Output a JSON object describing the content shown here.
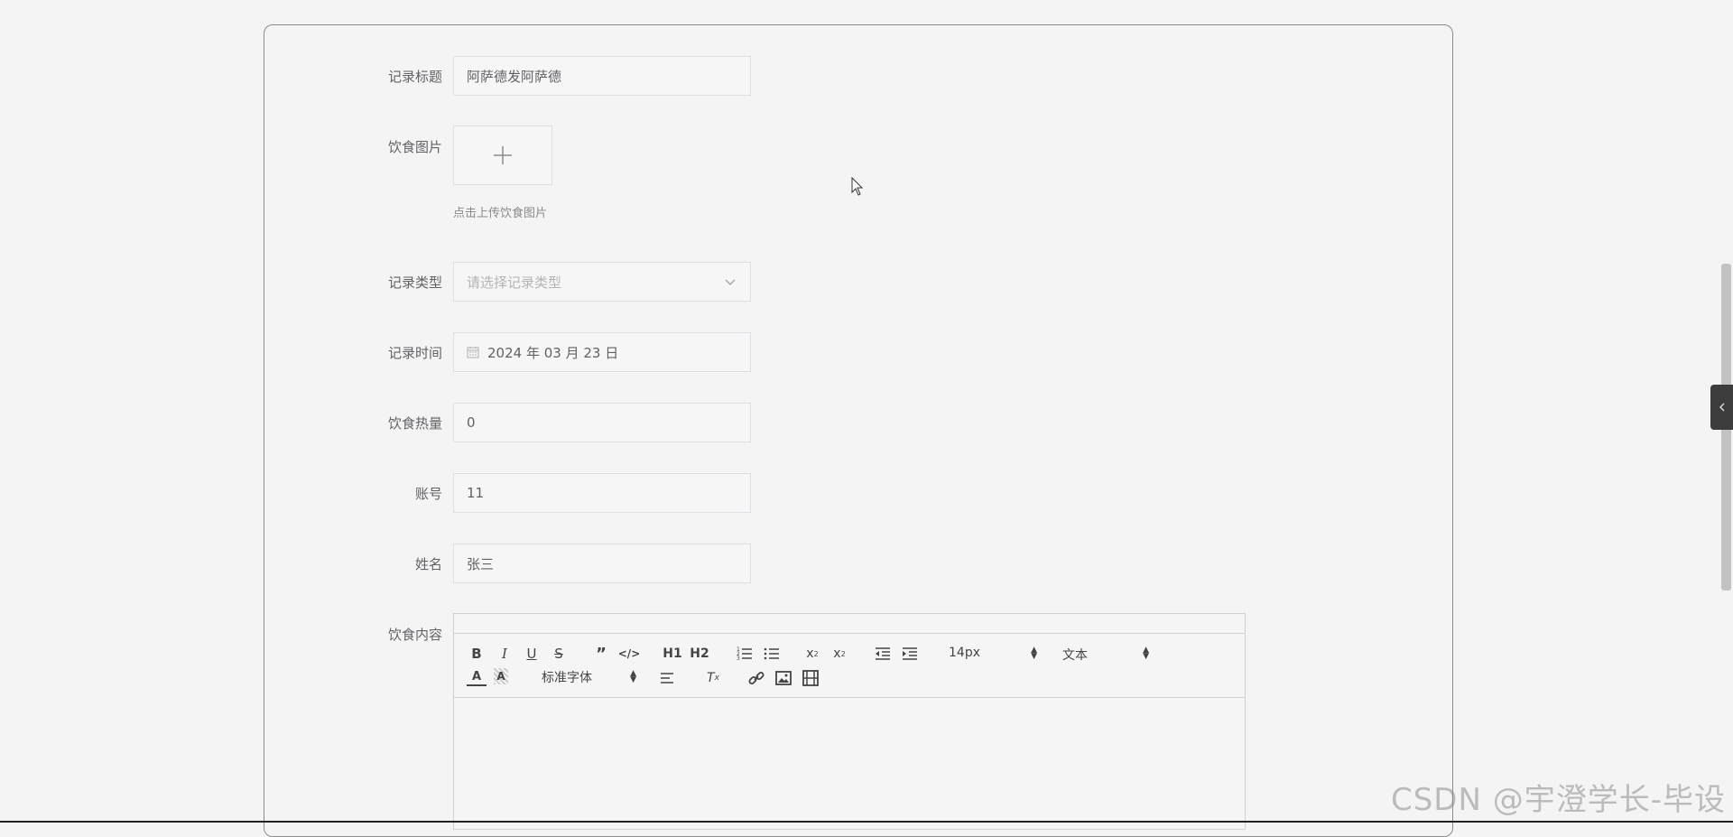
{
  "form": {
    "title_label": "记录标题",
    "title_value": "阿萨德发阿萨德",
    "image_label": "饮食图片",
    "image_hint": "点击上传饮食图片",
    "type_label": "记录类型",
    "type_placeholder": "请选择记录类型",
    "time_label": "记录时间",
    "time_value": "2024 年 03 月 23 日",
    "calories_label": "饮食热量",
    "calories_value": "0",
    "account_label": "账号",
    "account_value": "11",
    "name_label": "姓名",
    "name_value": "张三",
    "content_label": "饮食内容"
  },
  "editor": {
    "font_size": "14px",
    "header_select": "文本",
    "font_family": "标准字体",
    "h1": "H1",
    "h2": "H2"
  },
  "watermark": "CSDN @宇澄学长-毕设",
  "icons": [
    "plus-icon",
    "chevron-down-icon",
    "calendar-icon",
    "bold-icon",
    "italic-icon",
    "underline-icon",
    "strike-icon",
    "blockquote-icon",
    "code-icon",
    "ordered-list-icon",
    "bullet-list-icon",
    "subscript-icon",
    "superscript-icon",
    "outdent-icon",
    "indent-icon",
    "font-color-icon",
    "background-color-icon",
    "align-icon",
    "clear-format-icon",
    "link-icon",
    "image-icon",
    "video-icon",
    "chevron-left-icon",
    "cursor-icon"
  ]
}
